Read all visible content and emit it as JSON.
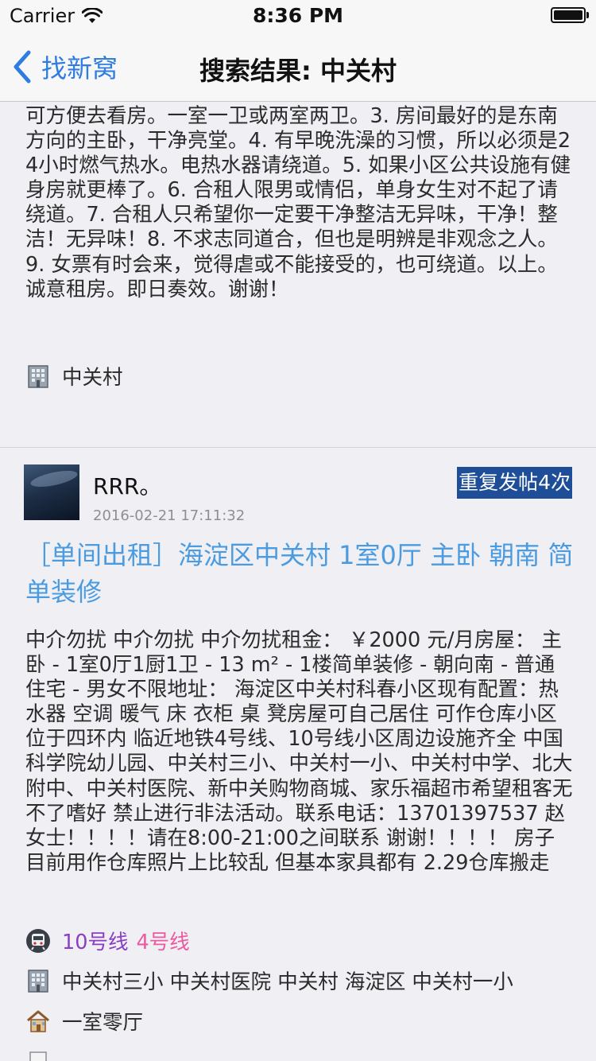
{
  "status_bar": {
    "carrier": "Carrier",
    "time": "8:36 PM",
    "battery_level": 1.0
  },
  "nav": {
    "back_label": "找新窝",
    "title": "搜索结果: 中关村"
  },
  "posts": [
    {
      "body": "可方便去看房。一室一卫或两室两卫。3. 房间最好的是东南方向的主卧，干净亮堂。4. 有早晚洗澡的习惯，所以必须是24小时燃气热水。电热水器请绕道。5. 如果小区公共设施有健身房就更棒了。6. 合租人限男或情侣，单身女生对不起了请绕道。7. 合租人只希望你一定要干净整洁无异味，干净！整洁！无异味！8. 不求志同道合，但也是明辨是非观念之人。9. 女票有时会来，觉得虐或不能接受的，也可绕道。以上。诚意租房。即日奏效。谢谢！",
      "location_icon": "building-icon",
      "location": "中关村"
    },
    {
      "author": "RRR。",
      "date": "2016-02-21 17:11:32",
      "repost_badge": "重复发帖4次",
      "title": "［单间出租］海淀区中关村 1室0厅 主卧 朝南 简单装修",
      "body": "中介勿扰 中介勿扰 中介勿扰租金： ￥2000 元/月房屋： 主卧 - 1室0厅1厨1卫 - 13 m² - 1楼简单装修 - 朝向南 - 普通住宅 - 男女不限地址： 海淀区中关村科春小区现有配置：热水器 空调 暖气 床 衣柜 桌 凳房屋可自己居住 可作仓库小区位于四环内 临近地铁4号线、10号线小区周边设施齐全 中国科学院幼儿园、中关村三小、中关村一小、中关村中学、北大附中、中关村医院、新中关购物商城、家乐福超市希望租客无不了嗜好 禁止进行非法活动。联系电话：13701397537 赵女士！！！！请在8:00-21:00之间联系 谢谢！！！！ 房子目前用作仓库照片上比较乱 但基本家具都有 2.29仓库搬走",
      "subway_icon": "subway-icon",
      "subway_lines": [
        {
          "name": "10号线",
          "color": "#8a3ec4"
        },
        {
          "name": "4号线",
          "color": "#ec5aa2"
        }
      ],
      "nearby_icon": "building-icon",
      "nearby": "中关村三小 中关村医院 中关村 海淀区 中关村一小",
      "layout_icon": "house-icon",
      "layout": "一室零厅"
    }
  ],
  "colors": {
    "accent": "#2f7de1",
    "title_link": "#4a9be0",
    "badge": "#1f4e99",
    "background": "#efeff4"
  }
}
